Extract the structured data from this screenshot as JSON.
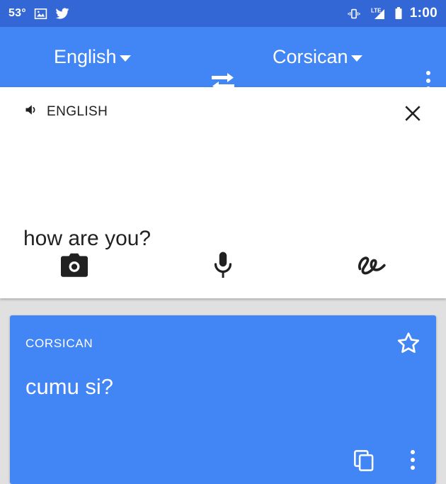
{
  "status_bar": {
    "temperature": "53°",
    "clock": "1:00",
    "icons": {
      "photo": "photo-icon",
      "twitter": "twitter-bird-icon",
      "vibrate": "vibrate-icon",
      "network": "lte-signal-icon",
      "network_label": "LTE",
      "battery": "battery-icon"
    },
    "background_color": "#3367d6",
    "text_color": "#ffffff"
  },
  "toolbar": {
    "source_language": "English",
    "target_language": "Corsican",
    "swap_icon": "swap-horizontal-icon",
    "overflow_icon": "more-vertical-icon",
    "caret_icon": "caret-down-icon",
    "background_color": "#4285f4"
  },
  "source_panel": {
    "language_label": "ENGLISH",
    "speaker_icon": "volume-up-icon",
    "close_icon": "close-icon",
    "text": "how are you?",
    "input_methods": [
      {
        "name": "camera",
        "icon": "camera-icon"
      },
      {
        "name": "voice",
        "icon": "microphone-icon"
      },
      {
        "name": "handwriting",
        "icon": "handwriting-icon"
      }
    ],
    "background_color": "#ffffff",
    "text_color": "#212121"
  },
  "result_card": {
    "language_label": "CORSICAN",
    "text": "cumu si?",
    "star_icon": "star-outline-icon",
    "copy_icon": "copy-icon",
    "overflow_icon": "more-vertical-icon",
    "background_color": "#4285f4",
    "text_color": "#ffffff"
  },
  "page_background_color": "#e0e0e0"
}
